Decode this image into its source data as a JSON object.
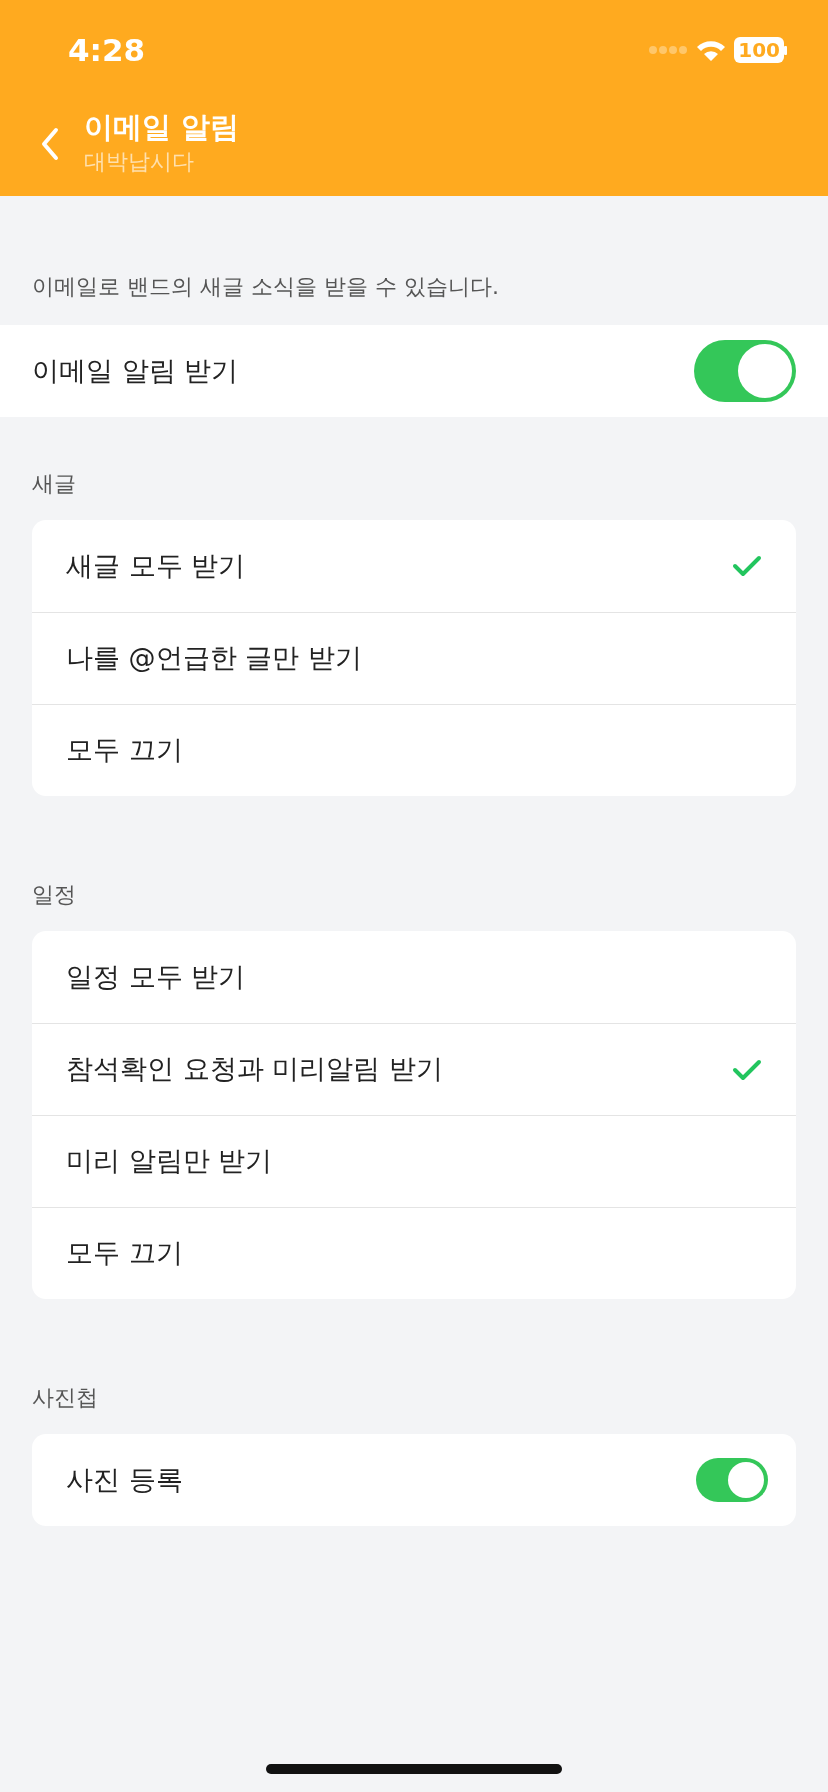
{
  "status_bar": {
    "time": "4:28",
    "battery": "100"
  },
  "header": {
    "title": "이메일 알림",
    "subtitle": "대박납시다"
  },
  "description": "이메일로 밴드의 새글 소식을 받을 수 있습니다.",
  "master_toggle": {
    "label": "이메일 알림 받기",
    "on": true
  },
  "sections": [
    {
      "title": "새글",
      "items": [
        {
          "kind": "option",
          "label": "새글 모두 받기",
          "selected": true
        },
        {
          "kind": "option",
          "label": "나를 @언급한 글만 받기",
          "selected": false
        },
        {
          "kind": "option",
          "label": "모두 끄기",
          "selected": false
        }
      ]
    },
    {
      "title": "일정",
      "items": [
        {
          "kind": "option",
          "label": "일정 모두 받기",
          "selected": false
        },
        {
          "kind": "option",
          "label": "참석확인 요청과 미리알림 받기",
          "selected": true
        },
        {
          "kind": "option",
          "label": "미리 알림만 받기",
          "selected": false
        },
        {
          "kind": "option",
          "label": "모두 끄기",
          "selected": false
        }
      ]
    },
    {
      "title": "사진첩",
      "items": [
        {
          "kind": "toggle",
          "label": "사진 등록",
          "on": true
        }
      ]
    }
  ]
}
